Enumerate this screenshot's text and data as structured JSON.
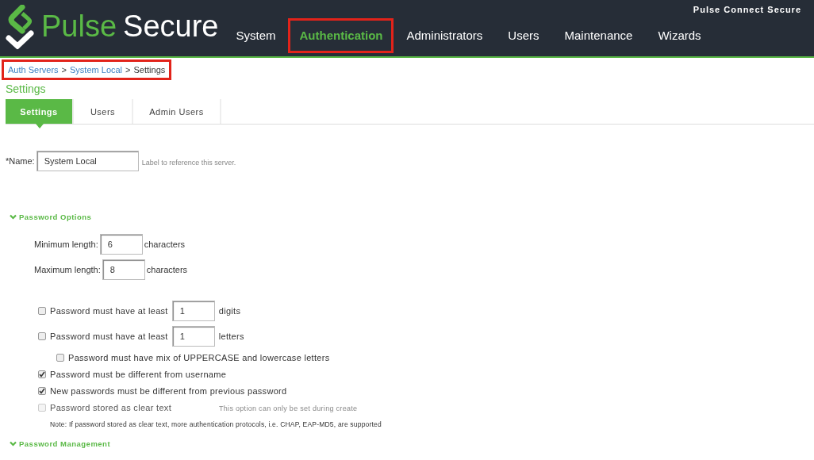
{
  "header": {
    "brand_green": "Pulse",
    "brand_white": "Secure",
    "product": "Pulse Connect Secure"
  },
  "nav": [
    {
      "label": "System",
      "selected": false,
      "highlighted": false
    },
    {
      "label": "Authentication",
      "selected": true,
      "highlighted": true
    },
    {
      "label": "Administrators",
      "selected": false,
      "highlighted": false
    },
    {
      "label": "Users",
      "selected": false,
      "highlighted": false
    },
    {
      "label": "Maintenance",
      "selected": false,
      "highlighted": false
    },
    {
      "label": "Wizards",
      "selected": false,
      "highlighted": false
    }
  ],
  "breadcrumb": {
    "highlighted": true,
    "links": [
      "Auth Servers",
      "System Local"
    ],
    "separator": ">",
    "current": "Settings"
  },
  "page_title": "Settings",
  "tabs": [
    {
      "label": "Settings",
      "selected": true
    },
    {
      "label": "Users",
      "selected": false
    },
    {
      "label": "Admin Users",
      "selected": false
    }
  ],
  "name_field": {
    "label": "*Name:",
    "value": "System Local",
    "hint": "Label to reference this server."
  },
  "sections": [
    {
      "title": "Password Options",
      "expanded": true
    },
    {
      "title": "Password Management",
      "expanded": true
    }
  ],
  "lengths": [
    {
      "label": "Minimum length:",
      "value": "6",
      "unit": "characters"
    },
    {
      "label": "Maximum length:",
      "value": "8",
      "unit": "characters"
    }
  ],
  "options": [
    {
      "kind": "number",
      "label": "Password must have at least",
      "value": "1",
      "unit": "digits",
      "checked": false,
      "disabled": false
    },
    {
      "kind": "number",
      "label": "Password must have at least",
      "value": "1",
      "unit": "letters",
      "checked": false,
      "disabled": false,
      "children": [
        {
          "kind": "plain",
          "label": "Password must have mix of UPPERCASE and lowercase letters",
          "checked": false,
          "disabled": false
        }
      ]
    },
    {
      "kind": "plain",
      "label": "Password must be different from username",
      "checked": true,
      "disabled": false
    },
    {
      "kind": "plain",
      "label": "New passwords must be different from previous password",
      "checked": true,
      "disabled": false
    },
    {
      "kind": "plain",
      "label": "Password stored as clear text",
      "checked": false,
      "disabled": true,
      "hint": "This option can only be set during create"
    }
  ],
  "note": "Note: If password stored as clear text, more authentication protocols, i.e. CHAP, EAP-MD5, are supported"
}
